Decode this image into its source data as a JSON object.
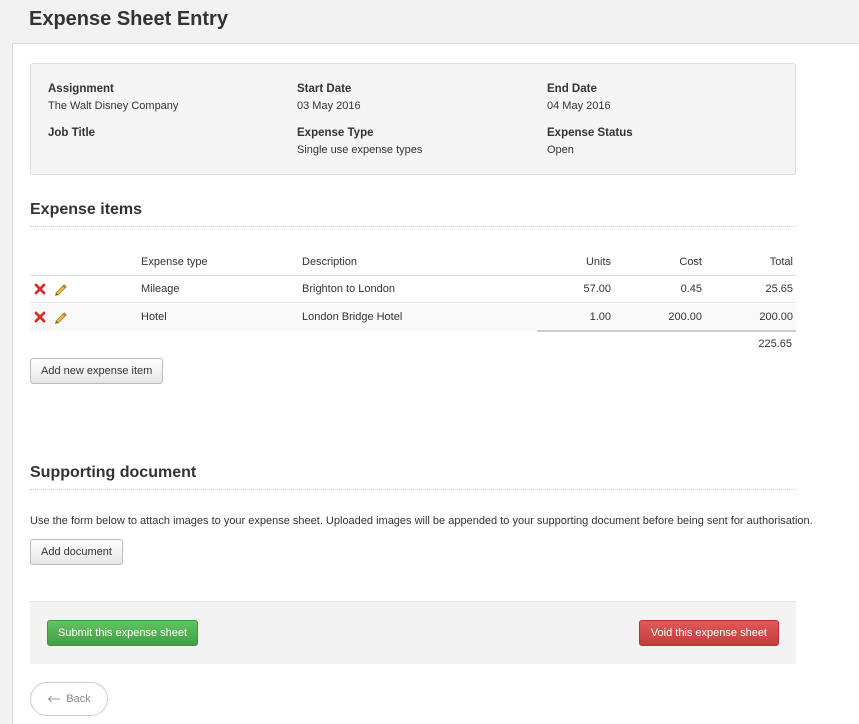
{
  "page": {
    "title": "Expense Sheet Entry"
  },
  "info": {
    "assignment": {
      "label": "Assignment",
      "value": "The Walt Disney Company"
    },
    "start_date": {
      "label": "Start Date",
      "value": "03 May 2016"
    },
    "end_date": {
      "label": "End Date",
      "value": "04 May 2016"
    },
    "job_title": {
      "label": "Job Title",
      "value": ""
    },
    "expense_type": {
      "label": "Expense Type",
      "value": "Single use expense types"
    },
    "expense_status": {
      "label": "Expense Status",
      "value": "Open"
    }
  },
  "expense_items": {
    "title": "Expense items",
    "columns": {
      "type": "Expense type",
      "description": "Description",
      "units": "Units",
      "cost": "Cost",
      "total": "Total"
    },
    "rows": [
      {
        "type": "Mileage",
        "description": "Brighton to London",
        "units": "57.00",
        "cost": "0.45",
        "total": "25.65"
      },
      {
        "type": "Hotel",
        "description": "London Bridge Hotel",
        "units": "1.00",
        "cost": "200.00",
        "total": "200.00"
      }
    ],
    "grand_total": "225.65",
    "add_button": "Add new expense item"
  },
  "supporting_document": {
    "title": "Supporting document",
    "description": "Use the form below to attach images to your expense sheet. Uploaded images will be appended to your supporting document before being sent for authorisation.",
    "add_button": "Add document"
  },
  "actions": {
    "submit": "Submit this expense sheet",
    "void": "Void this expense sheet",
    "back": "Back"
  },
  "icons": {
    "delete": "delete-icon",
    "edit": "pencil-icon",
    "back_arrow": "arrow-left-icon"
  },
  "colors": {
    "submit": "#4cae4c",
    "void": "#d9534f",
    "delete_icon": "#d9302a",
    "edit_icon": "#e0b030"
  }
}
